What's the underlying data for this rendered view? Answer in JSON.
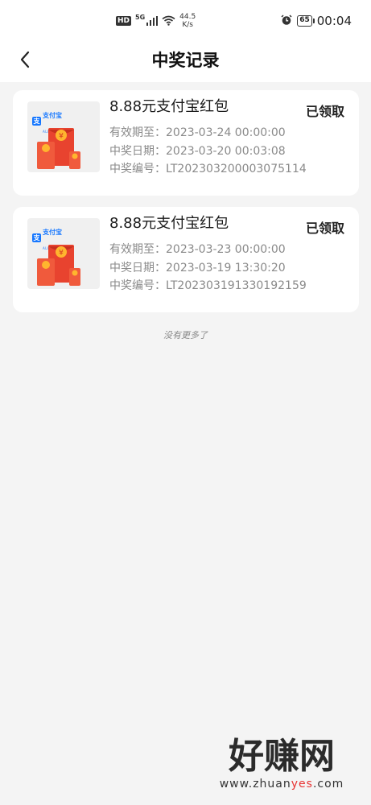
{
  "status_bar": {
    "hd": "HD",
    "network": "5G",
    "speed_value": "44.5",
    "speed_unit": "K/s",
    "battery": "65",
    "time": "00:04"
  },
  "header": {
    "title": "中奖记录"
  },
  "records": [
    {
      "thumb_brand": "支付宝",
      "thumb_brand_sub": "ALIPAY",
      "name": "8.88元支付宝红包",
      "status": "已领取",
      "valid_until": "有效期至：2023-03-24 00:00:00",
      "win_date": "中奖日期：2023-03-20 00:03:08",
      "win_no": "中奖编号：LT202303200003075114"
    },
    {
      "thumb_brand": "支付宝",
      "thumb_brand_sub": "ALIPAY",
      "name": "8.88元支付宝红包",
      "status": "已领取",
      "valid_until": "有效期至：2023-03-23 00:00:00",
      "win_date": "中奖日期：2023-03-19 13:30:20",
      "win_no": "中奖编号：LT202303191330192159"
    }
  ],
  "footer": {
    "no_more": "没有更多了"
  },
  "watermark": {
    "logo": "好赚网",
    "url_prefix": "www.zhuan",
    "url_highlight": "yes",
    "url_suffix": ".com"
  },
  "colors": {
    "background": "#f4f4f4",
    "card": "#ffffff",
    "alipay_blue": "#1677ff",
    "red_packet": "#e8432f",
    "coin_gold": "#ffb52e"
  },
  "icons": {
    "back": "chevron-left-icon",
    "alarm": "alarm-clock-icon",
    "wifi": "wifi-icon",
    "signal": "signal-bars-icon"
  }
}
